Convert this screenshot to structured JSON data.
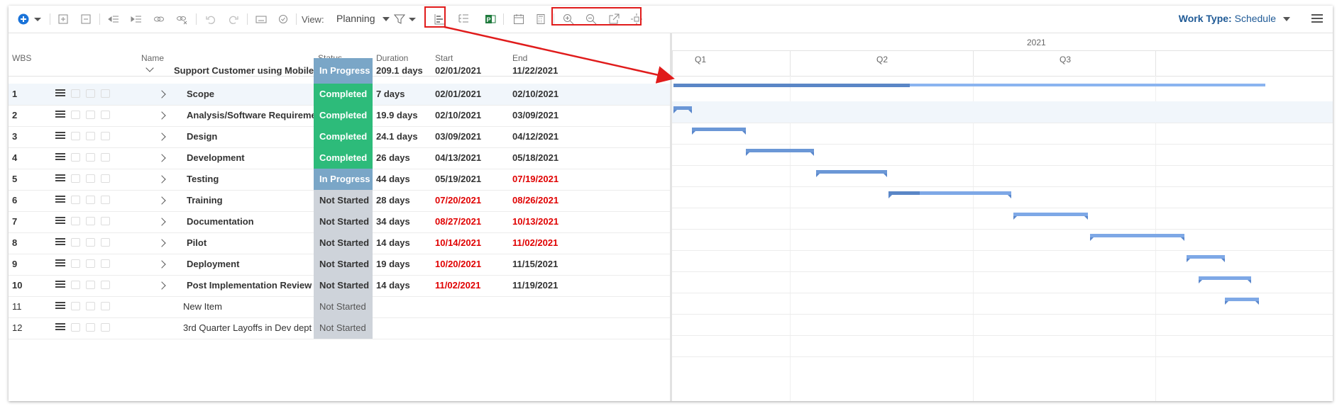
{
  "toolbar": {
    "view_label": "View:",
    "view_value": "Planning",
    "work_type_label": "Work Type:",
    "work_type_value": "Schedule"
  },
  "columns": {
    "wbs": "WBS",
    "name": "Name",
    "status": "Status",
    "duration": "Duration",
    "start": "Start",
    "end": "End"
  },
  "summary": {
    "name": "Support Customer using Mobile",
    "status": "In Progress",
    "duration": "209.1 days",
    "start": "02/01/2021",
    "end": "11/22/2021"
  },
  "rows": [
    {
      "wbs": "1",
      "name": "Scope",
      "status": "Completed",
      "duration": "7 days",
      "start": "02/01/2021",
      "end": "02/10/2021"
    },
    {
      "wbs": "2",
      "name": "Analysis/Software Requirements",
      "status": "Completed",
      "duration": "19.9 days",
      "start": "02/10/2021",
      "end": "03/09/2021"
    },
    {
      "wbs": "3",
      "name": "Design",
      "status": "Completed",
      "duration": "24.1 days",
      "start": "03/09/2021",
      "end": "04/12/2021"
    },
    {
      "wbs": "4",
      "name": "Development",
      "status": "Completed",
      "duration": "26 days",
      "start": "04/13/2021",
      "end": "05/18/2021"
    },
    {
      "wbs": "5",
      "name": "Testing",
      "status": "In Progress",
      "duration": "44 days",
      "start": "05/19/2021",
      "end": "07/19/2021"
    },
    {
      "wbs": "6",
      "name": "Training",
      "status": "Not Started",
      "duration": "28 days",
      "start": "07/20/2021",
      "end": "08/26/2021"
    },
    {
      "wbs": "7",
      "name": "Documentation",
      "status": "Not Started",
      "duration": "34 days",
      "start": "08/27/2021",
      "end": "10/13/2021"
    },
    {
      "wbs": "8",
      "name": "Pilot",
      "status": "Not Started",
      "duration": "14 days",
      "start": "10/14/2021",
      "end": "11/02/2021"
    },
    {
      "wbs": "9",
      "name": "Deployment",
      "status": "Not Started",
      "duration": "19 days",
      "start": "10/20/2021",
      "end": "11/15/2021"
    },
    {
      "wbs": "10",
      "name": "Post Implementation Review",
      "status": "Not Started",
      "duration": "14 days",
      "start": "11/02/2021",
      "end": "11/19/2021"
    },
    {
      "wbs": "11",
      "name": "New Item",
      "status": "Not Started",
      "duration": "",
      "start": "",
      "end": ""
    },
    {
      "wbs": "12",
      "name": "3rd Quarter Layoffs in Dev dept",
      "status": "Not Started",
      "duration": "",
      "start": "",
      "end": ""
    }
  ],
  "gantt": {
    "year": "2021",
    "quarters": [
      "Q1",
      "Q2",
      "Q3"
    ]
  },
  "colors": {
    "in_progress": "#7aa6c7",
    "completed": "#2dbb7a",
    "not_started": "#ced3da",
    "late_date": "#e00000",
    "annotation": "#e01b1b",
    "accent": "#1f5a96"
  }
}
